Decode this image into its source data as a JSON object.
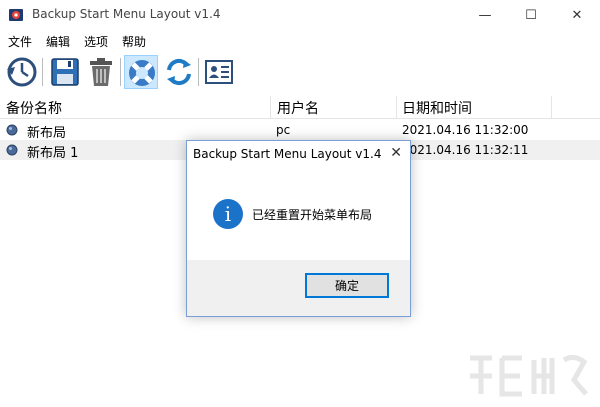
{
  "window": {
    "title": "Backup Start Menu Layout v1.4",
    "minimize_glyph": "—",
    "maximize_glyph": "☐",
    "close_glyph": "✕"
  },
  "menu": {
    "items": [
      {
        "label": "文件"
      },
      {
        "label": "编辑"
      },
      {
        "label": "选项"
      },
      {
        "label": "帮助"
      }
    ]
  },
  "toolbar": {
    "icons": [
      "backup-clock-icon",
      "save-disk-icon",
      "trash-icon",
      "lifebuoy-icon",
      "refresh-icon",
      "contact-card-icon"
    ],
    "active_icon": "lifebuoy-icon"
  },
  "list": {
    "columns": [
      {
        "label": "备份名称"
      },
      {
        "label": "用户名"
      },
      {
        "label": "日期和时间"
      }
    ],
    "rows": [
      {
        "name": "新布局",
        "user": "pc",
        "datetime": "2021.04.16 11:32:00"
      },
      {
        "name": "新布局 1",
        "user": "",
        "datetime": "2021.04.16 11:32:11"
      }
    ]
  },
  "dialog": {
    "title": "Backup Start Menu Layout v1.4",
    "close_glyph": "✕",
    "message": "已经重置开始菜单布局",
    "info_glyph": "i",
    "ok_label": "确定"
  },
  "colors": {
    "accent": "#0078d7",
    "info_blue": "#1a73c9",
    "selected_row": "#f0f0f0",
    "dialog_footer": "#f0f0f0"
  }
}
